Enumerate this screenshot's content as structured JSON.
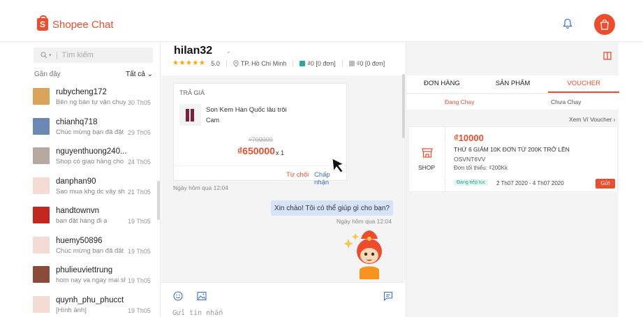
{
  "app": {
    "title": "Shopee Chat"
  },
  "sidebar": {
    "search_placeholder": "Tìm kiếm",
    "filter_recent": "Gần đây",
    "filter_all": "Tất cả",
    "conversations": [
      {
        "name": "rubycheng172",
        "preview": "Bên ng bán tự vận chuyể",
        "date": "30 Th05",
        "avatar_color": "#d9a35a"
      },
      {
        "name": "chianhq718",
        "preview": "Chúc mừng bạn đã đặt h",
        "date": "29 Th05",
        "avatar_color": "#6b87b3"
      },
      {
        "name": "nguyenthuong240...",
        "preview": "Shop có giao hàng cho b",
        "date": "24 Th05",
        "avatar_color": "#b7a9a0"
      },
      {
        "name": "danphan90",
        "preview": "Sao mua khg dc vậy sh",
        "date": "21 Th05",
        "avatar_color": "#f4dcd5"
      },
      {
        "name": "handtownvn",
        "preview": "bạn đặt hàng đi ạ",
        "date": "19 Th05",
        "avatar_color": "#c0271e"
      },
      {
        "name": "huemy50896",
        "preview": "Chúc mừng bạn đã đặt h",
        "date": "19 Th05",
        "avatar_color": "#f4dcd5"
      },
      {
        "name": "phulieuviettrung",
        "preview": "hom nay va ngay mai sh",
        "date": "19 Th05",
        "avatar_color": "#8a4b3a"
      },
      {
        "name": "quynh_phu_phucct",
        "preview": "[Hình ảnh]",
        "date": "19 Th05",
        "avatar_color": "#f4dcd5"
      }
    ]
  },
  "chat": {
    "username": "hilan32",
    "rating": "5.0",
    "location": "TP. Hồ Chí Minh",
    "orders_done": "₫0 [0 đơn]",
    "orders_other": "₫0 [0 đơn]",
    "offer": {
      "title": "TRẢ GIÁ",
      "product_name": "Son Kem Hàn Quốc lâu trôi",
      "variant": "Cam",
      "old_price": "₫700000",
      "new_price": "₫650000",
      "quantity": "x 1",
      "reject_label": "Từ chối",
      "accept_label": "Chấp nhận"
    },
    "offer_time": "Ngày hôm qua 12:04",
    "message": "Xin chào! Tôi có thể giúp gì cho bạn?",
    "message_time": "Ngày hôm qua 12:04",
    "input_placeholder": "Gửi tin nhắn"
  },
  "right_panel": {
    "tabs": [
      "ĐƠN HÀNG",
      "SẢN PHẨM",
      "VOUCHER"
    ],
    "active_tab": "VOUCHER",
    "subtabs": [
      "Đang Chạy",
      "Chưa Chạy"
    ],
    "see_all": "Xem Ví Voucher ›",
    "voucher": {
      "shop_label": "SHOP",
      "amount": "₫10000",
      "description": "THỨ 6 GIẢM 10K ĐƠN TỪ 200K TRỞ LÊN",
      "code": "OSVNT6VV",
      "min_order": "Đơn tối thiểu: ₫200Kk",
      "status": "Đang tiếp tục",
      "dates": "2 Th07 2020 - 4 Th07 2020",
      "send_label": "Gửi"
    }
  },
  "colors": {
    "brand": "#ee4d2d",
    "link": "#3a6fd8",
    "bubble": "#d6e4fb",
    "success": "#26aa99"
  }
}
